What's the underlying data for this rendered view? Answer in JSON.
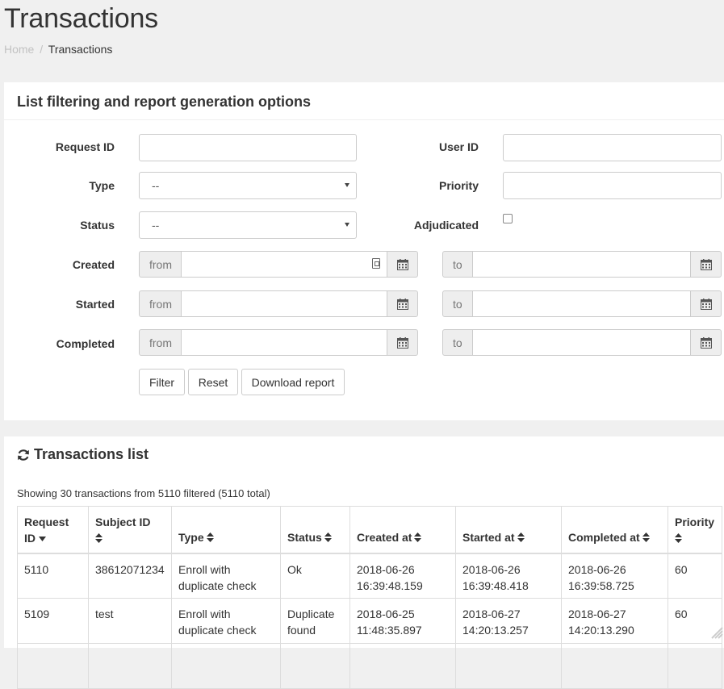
{
  "header": {
    "title": "Transactions",
    "breadcrumb": {
      "home": "Home",
      "separator": "/",
      "current": "Transactions"
    }
  },
  "filter_panel": {
    "title": "List filtering and report generation options",
    "request_id": {
      "label": "Request ID",
      "value": ""
    },
    "user_id": {
      "label": "User ID",
      "value": ""
    },
    "type": {
      "label": "Type",
      "selected": "--"
    },
    "priority": {
      "label": "Priority",
      "value": ""
    },
    "status": {
      "label": "Status",
      "selected": "--"
    },
    "adjudicated": {
      "label": "Adjudicated",
      "checked": false
    },
    "created": {
      "label": "Created",
      "from_addon": "from",
      "to_addon": "to",
      "from_value": "",
      "to_value": ""
    },
    "started": {
      "label": "Started",
      "from_addon": "from",
      "to_addon": "to",
      "from_value": "",
      "to_value": ""
    },
    "completed": {
      "label": "Completed",
      "from_addon": "from",
      "to_addon": "to",
      "from_value": "",
      "to_value": ""
    },
    "buttons": {
      "filter": "Filter",
      "reset": "Reset",
      "download": "Download report"
    }
  },
  "list_panel": {
    "title": "Transactions list",
    "summary": "Showing 30 transactions from 5110 filtered (5110 total)",
    "columns": {
      "request_id_1": "Request",
      "request_id_2": "ID",
      "subject_id": "Subject ID",
      "type": "Type",
      "status": "Status",
      "created_at": "Created at",
      "started_at": "Started at",
      "completed_at": "Completed at",
      "priority": "Priority"
    },
    "rows": [
      {
        "request_id": "5110",
        "subject_id": "38612071234",
        "type_1": "Enroll with",
        "type_2": "duplicate check",
        "status_1": "Ok",
        "status_2": "",
        "created_date": "2018-06-26",
        "created_time": "16:39:48.159",
        "started_date": "2018-06-26",
        "started_time": "16:39:48.418",
        "completed_date": "2018-06-26",
        "completed_time": "16:39:58.725",
        "priority": "60"
      },
      {
        "request_id": "5109",
        "subject_id": "test",
        "type_1": "Enroll with",
        "type_2": "duplicate check",
        "status_1": "Duplicate",
        "status_2": "found",
        "created_date": "2018-06-25",
        "created_time": "11:48:35.897",
        "started_date": "2018-06-27",
        "started_time": "14:20:13.257",
        "completed_date": "2018-06-27",
        "completed_time": "14:20:13.290",
        "priority": "60"
      }
    ]
  },
  "icons": {
    "refresh": "refresh-icon",
    "calendar": "calendar-icon",
    "sort": "sort-icon",
    "sort_down": "sort-down-icon",
    "date_picker": "date-picker-icon"
  },
  "colors": {
    "background": "#f0f0f0",
    "panel": "#ffffff",
    "border": "#cccccc",
    "addon": "#eeeeee",
    "muted": "#c2c2c2"
  }
}
